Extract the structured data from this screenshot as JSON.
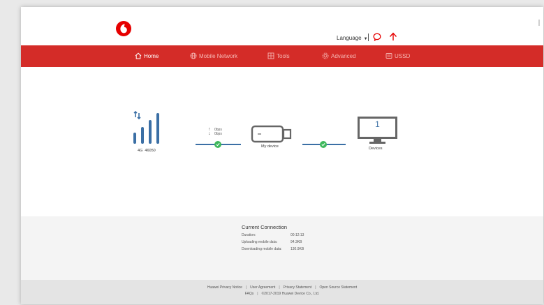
{
  "header": {
    "language_label": "Language",
    "icons": [
      "vodafone-logo",
      "message-icon",
      "upload-arrow-icon"
    ]
  },
  "nav": {
    "items": [
      {
        "label": "Home",
        "icon": "home-icon",
        "active": true
      },
      {
        "label": "Mobile Network",
        "icon": "globe-icon",
        "active": false
      },
      {
        "label": "Tools",
        "icon": "tools-icon",
        "active": false
      },
      {
        "label": "Advanced",
        "icon": "gear-icon",
        "active": false
      },
      {
        "label": "USSD",
        "icon": "ussd-icon",
        "active": false
      }
    ]
  },
  "status": {
    "network_type": "4G",
    "operator": "46050",
    "upload_rate": "0bps",
    "download_rate": "0bps",
    "device_label": "My device",
    "devices_count": "1",
    "devices_label": "Devices"
  },
  "connection": {
    "title": "Current Connection",
    "rows": [
      {
        "label": "Duration:",
        "value": "00:12:13"
      },
      {
        "label": "Uploading mobile data:",
        "value": "94.3KB"
      },
      {
        "label": "Downloading mobile data:",
        "value": "130.9KB"
      }
    ]
  },
  "footer": {
    "links": [
      "Huawei Privacy Notice",
      "User Agreement",
      "Privacy Statement",
      "Open Source Statement"
    ],
    "faqs": "FAQs",
    "copyright": "©2017-2019 Huawei Device Co., Ltd."
  },
  "colors": {
    "brand_red": "#d42c28",
    "link_blue": "#3b6fa5",
    "ok_green": "#3fb85d"
  }
}
